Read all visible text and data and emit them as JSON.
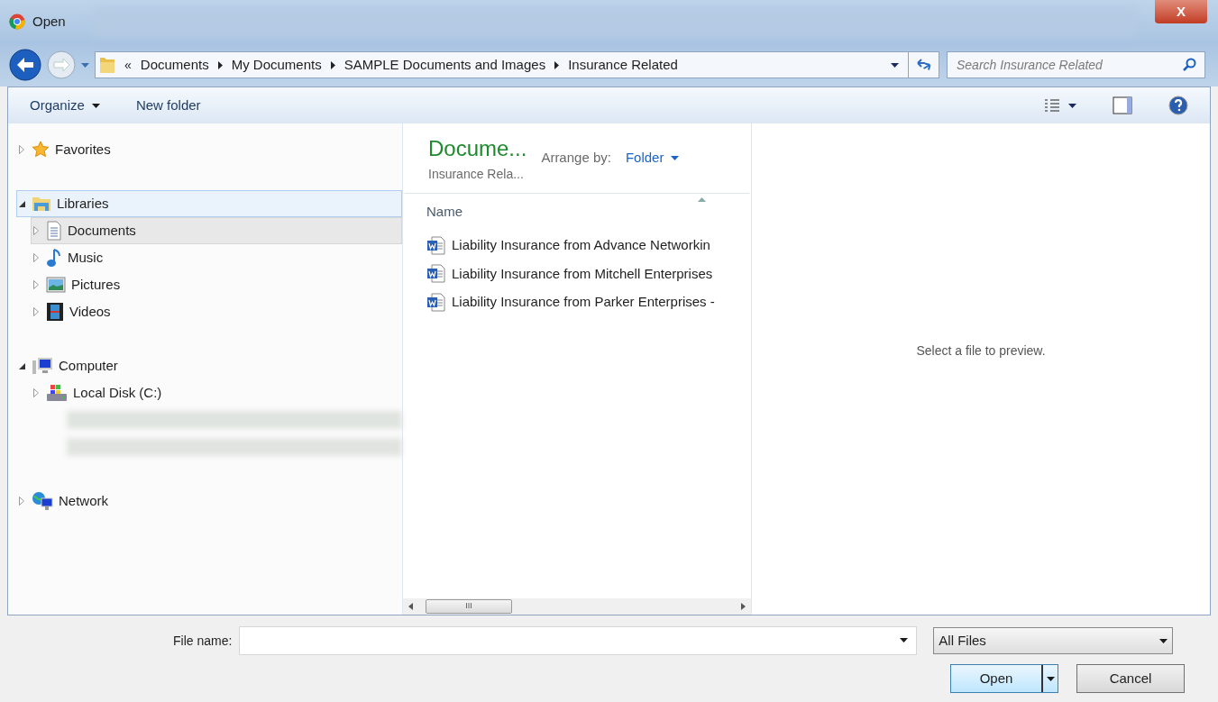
{
  "window": {
    "title": "Open",
    "close": "X"
  },
  "address_bar": {
    "overflow": "«",
    "crumbs": [
      "Documents",
      "My Documents",
      "SAMPLE Documents and Images",
      "Insurance Related"
    ]
  },
  "search": {
    "placeholder": "Search Insurance Related"
  },
  "toolbar": {
    "organize": "Organize",
    "new_folder": "New folder"
  },
  "tree": [
    {
      "label": "Favorites",
      "kind": "favorites",
      "expanded": false,
      "selected": false,
      "focused": false
    },
    {
      "label": "Libraries",
      "kind": "library",
      "expanded": true,
      "selected": false,
      "focused": true,
      "children": [
        {
          "label": "Documents",
          "kind": "documents",
          "expanded": false,
          "selected": true,
          "focused": false
        },
        {
          "label": "Music",
          "kind": "music",
          "expanded": false,
          "selected": false,
          "focused": false
        },
        {
          "label": "Pictures",
          "kind": "pictures",
          "expanded": false,
          "selected": false,
          "focused": false
        },
        {
          "label": "Videos",
          "kind": "videos",
          "expanded": false,
          "selected": false,
          "focused": false
        }
      ]
    },
    {
      "label": "Computer",
      "kind": "computer",
      "expanded": true,
      "selected": false,
      "focused": false,
      "children": [
        {
          "label": "Local Disk (C:)",
          "kind": "disk",
          "expanded": false,
          "selected": false,
          "focused": false
        },
        {
          "kind": "blurred"
        },
        {
          "kind": "blurred"
        }
      ]
    },
    {
      "label": "Network",
      "kind": "network",
      "expanded": false,
      "selected": false,
      "focused": false
    }
  ],
  "library_header": {
    "title": "Docume...",
    "subtitle": "Insurance Rela...",
    "arrange_label": "Arrange by:",
    "arrange_value": "Folder"
  },
  "file_list": {
    "column": "Name",
    "files": [
      "Liability Insurance from Advance Networkin",
      "Liability Insurance from Mitchell Enterprises",
      "Liability Insurance from Parker Enterprises -"
    ],
    "scroll_grip": "III"
  },
  "preview": {
    "message": "Select a file to preview."
  },
  "footer": {
    "file_name_label": "File name:",
    "file_type": "All Files",
    "open": "Open",
    "cancel": "Cancel"
  }
}
